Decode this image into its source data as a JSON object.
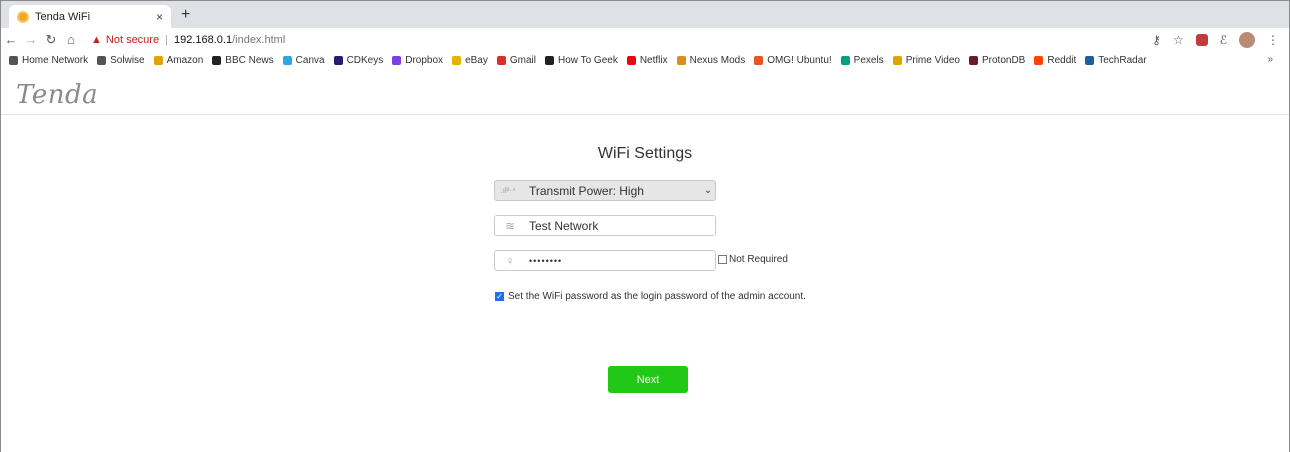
{
  "browser": {
    "tab_title": "Tenda WiFi",
    "tab_close": "×",
    "new_tab": "+",
    "not_secure": "Not secure",
    "separator": "|",
    "host": "192.168.0.1",
    "path": "/index.html"
  },
  "bookmarks": [
    {
      "label": "Home Network",
      "color": "#555555"
    },
    {
      "label": "Solwise",
      "color": "#555555"
    },
    {
      "label": "Amazon",
      "color": "#e0a400"
    },
    {
      "label": "BBC News",
      "color": "#222222"
    },
    {
      "label": "Canva",
      "color": "#2aa8e0"
    },
    {
      "label": "CDKeys",
      "color": "#2d1b6b"
    },
    {
      "label": "Dropbox",
      "color": "#7b3fe4"
    },
    {
      "label": "eBay",
      "color": "#e8b100"
    },
    {
      "label": "Gmail",
      "color": "#d93025"
    },
    {
      "label": "How To Geek",
      "color": "#222222"
    },
    {
      "label": "Netflix",
      "color": "#e50914"
    },
    {
      "label": "Nexus Mods",
      "color": "#d98f1f"
    },
    {
      "label": "OMG! Ubuntu!",
      "color": "#e95420"
    },
    {
      "label": "Pexels",
      "color": "#05a081"
    },
    {
      "label": "Prime Video",
      "color": "#e0a400"
    },
    {
      "label": "ProtonDB",
      "color": "#6b1a2a"
    },
    {
      "label": "Reddit",
      "color": "#ff4500"
    },
    {
      "label": "TechRadar",
      "color": "#1f5fa0"
    }
  ],
  "bookmarks_more": "»",
  "page": {
    "logo": "Tenda",
    "title": "WiFi Settings",
    "transmit_power": "Transmit Power: High",
    "ssid": "Test Network",
    "password_mask": "••••••••",
    "not_required": "Not Required",
    "admin_password_text": "Set the WiFi password as the login password of the admin account.",
    "admin_password_checked": true,
    "next_label": "Next"
  },
  "colors": {
    "next_button": "#21c818",
    "checkbox": "#1a73e8",
    "not_secure": "#c5221f"
  }
}
